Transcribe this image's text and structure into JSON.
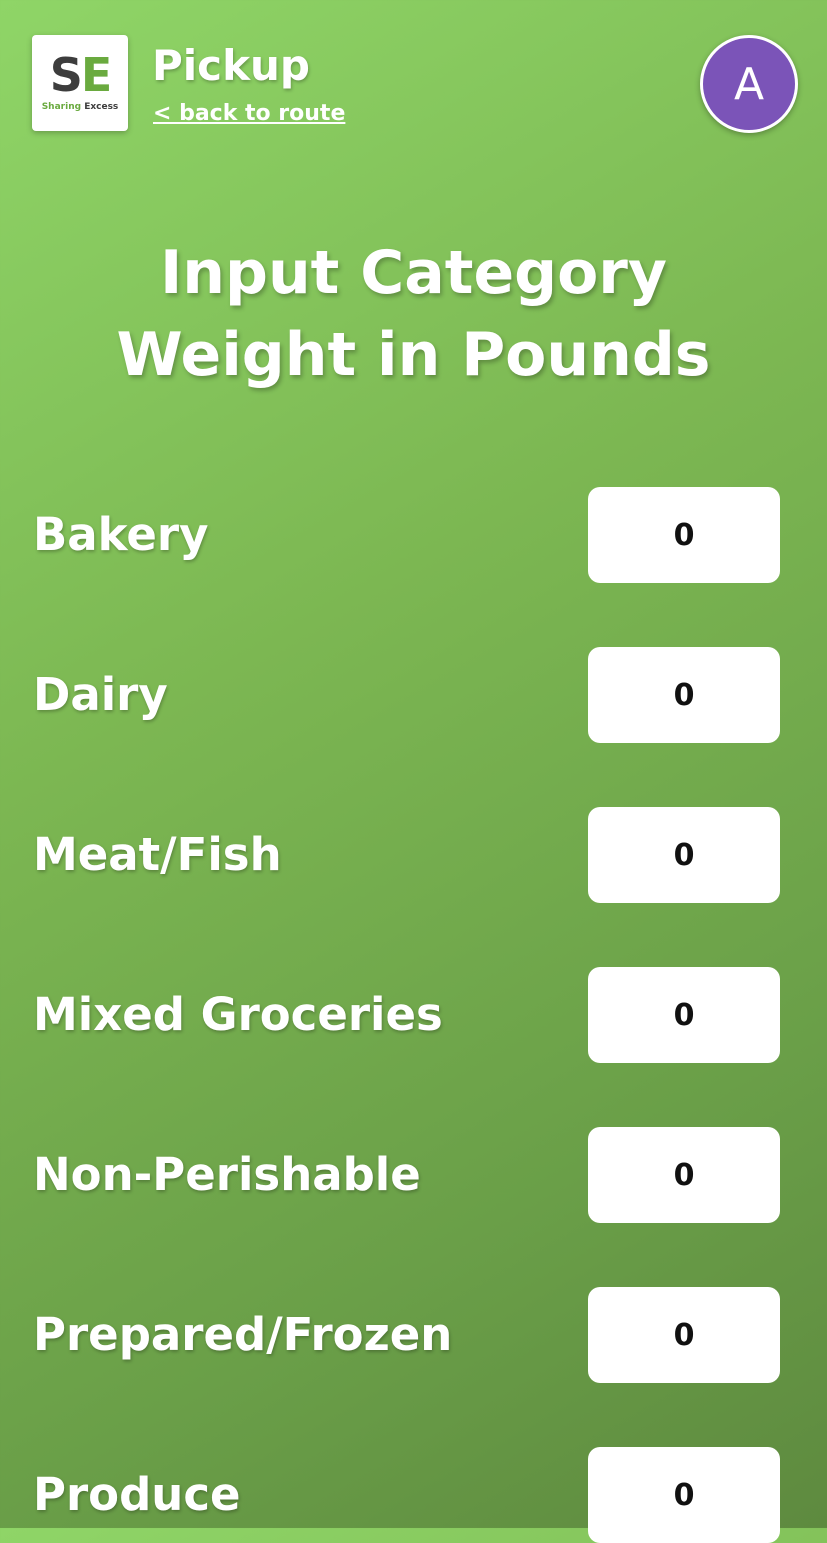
{
  "logo": {
    "letter_s": "S",
    "letter_e": "E",
    "tagline_a": "Sharing",
    "tagline_b": "Excess"
  },
  "header": {
    "title": "Pickup",
    "back_link": "< back to route",
    "avatar_initial": "A"
  },
  "heading": {
    "line1": "Input Category",
    "line2": "Weight in Pounds"
  },
  "categories": [
    {
      "label": "Bakery",
      "value": "0"
    },
    {
      "label": "Dairy",
      "value": "0"
    },
    {
      "label": "Meat/Fish",
      "value": "0"
    },
    {
      "label": "Mixed Groceries",
      "value": "0"
    },
    {
      "label": "Non-Perishable",
      "value": "0"
    },
    {
      "label": "Prepared/Frozen",
      "value": "0"
    },
    {
      "label": "Produce",
      "value": "0"
    }
  ],
  "colors": {
    "brand_green": "#6aaa3f",
    "brand_dark": "#3d3d3d",
    "avatar_purple": "#7b54b8"
  }
}
